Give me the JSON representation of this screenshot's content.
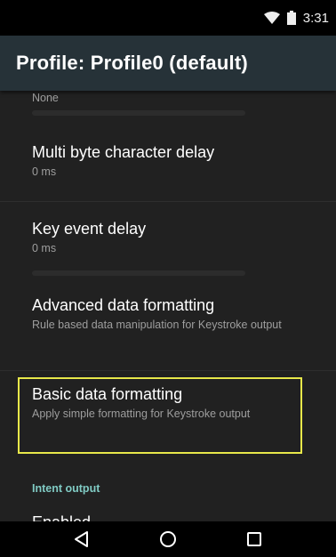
{
  "status_bar": {
    "time": "3:31",
    "icons": [
      "wifi-icon",
      "battery-icon"
    ]
  },
  "app_bar": {
    "title": "Profile: Profile0 (default)"
  },
  "preferences": {
    "partial_top_summary": "None",
    "items": [
      {
        "title": "Multi byte character delay",
        "summary": "0 ms"
      },
      {
        "title": "Key event delay",
        "summary": "0 ms"
      },
      {
        "title": "Advanced data formatting",
        "summary": "Rule based data manipulation for Keystroke output"
      },
      {
        "title": "Basic data formatting",
        "summary": "Apply simple formatting for Keystroke output"
      }
    ],
    "section_header": "Intent output",
    "partial_bottom_title": "Enabled"
  },
  "nav_bar": {
    "icons": [
      "back-icon",
      "home-icon",
      "recents-icon"
    ]
  },
  "colors": {
    "background": "#212121",
    "app_bar": "#263238",
    "section_header": "#80cbc4",
    "highlight": "#e8e84a"
  }
}
